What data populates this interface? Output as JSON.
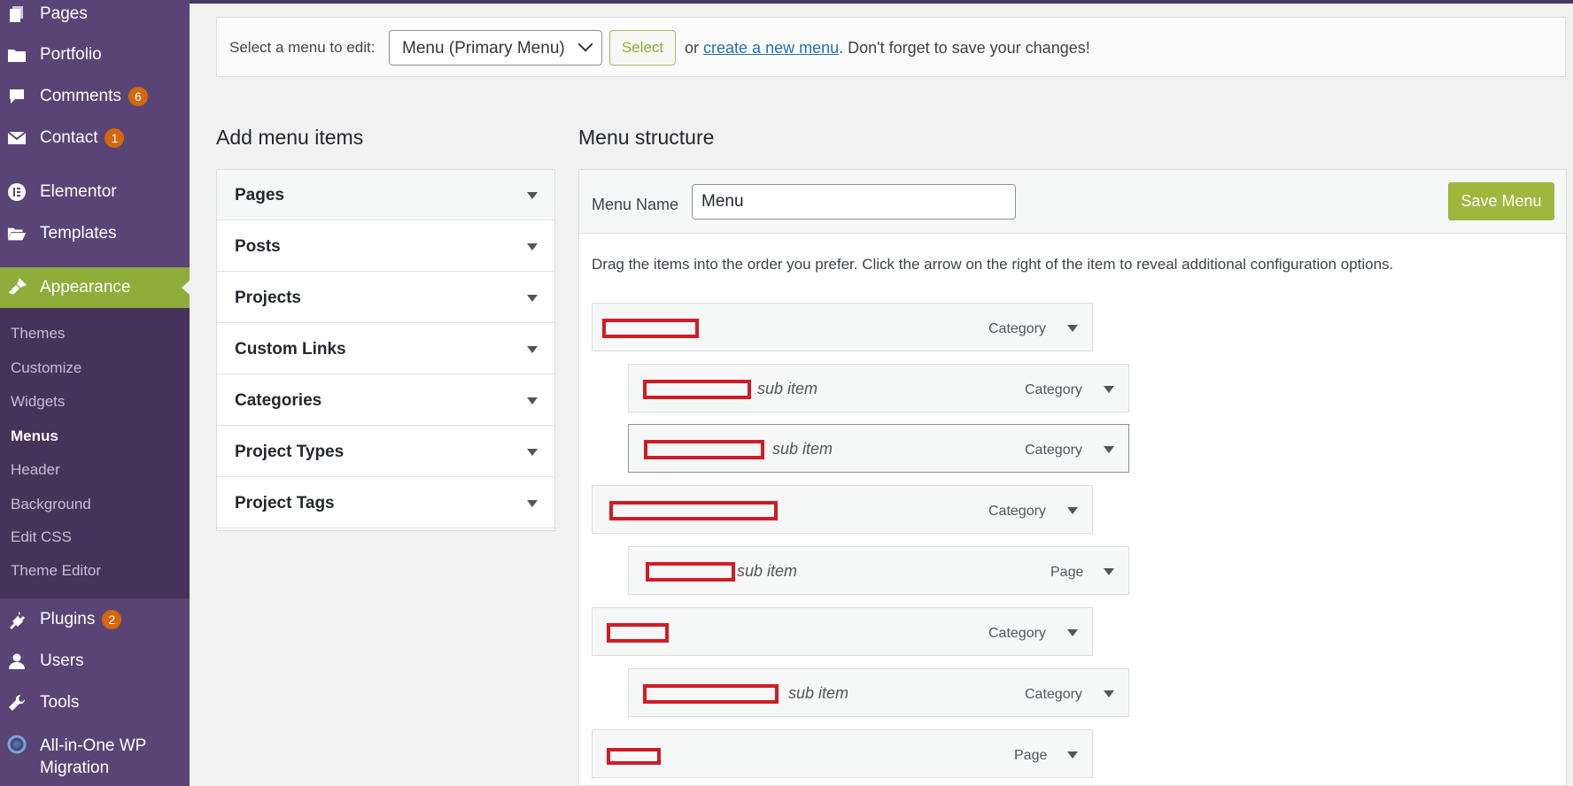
{
  "sidebar": {
    "items": [
      {
        "label": "Pages",
        "icon": "pages-icon"
      },
      {
        "label": "Portfolio",
        "icon": "folder-icon"
      },
      {
        "label": "Comments",
        "icon": "comment-icon",
        "badge": "6"
      },
      {
        "label": "Contact",
        "icon": "mail-icon",
        "badge": "1"
      },
      {
        "label": "Elementor",
        "icon": "elementor-icon"
      },
      {
        "label": "Templates",
        "icon": "folder-open-icon"
      },
      {
        "label": "Appearance",
        "icon": "brush-icon"
      },
      {
        "label": "Plugins",
        "icon": "plug-icon",
        "badge": "2"
      },
      {
        "label": "Users",
        "icon": "user-icon"
      },
      {
        "label": "Tools",
        "icon": "wrench-icon"
      },
      {
        "label": "All-in-One WP",
        "label2": "Migration",
        "icon": "migration-icon"
      }
    ],
    "submenu": [
      "Themes",
      "Customize",
      "Widgets",
      "Menus",
      "Header",
      "Background",
      "Edit CSS",
      "Theme Editor"
    ],
    "submenu_current": "Menus"
  },
  "selectbar": {
    "label": "Select a menu to edit:",
    "selected": "Menu (Primary Menu)",
    "select_button": "Select",
    "or": "or",
    "create_link": "create a new menu",
    "reminder": ". Don't forget to save your changes!"
  },
  "add_items": {
    "title": "Add menu items",
    "sections": [
      "Pages",
      "Posts",
      "Projects",
      "Custom Links",
      "Categories",
      "Project Types",
      "Project Tags"
    ]
  },
  "structure": {
    "title": "Menu structure",
    "menu_name_label": "Menu Name",
    "menu_name_value": "Menu",
    "save_button": "Save Menu",
    "instructions": "Drag the items into the order you prefer. Click the arrow on the right of the item to reveal additional configuration options.",
    "items": [
      {
        "sub_text": "",
        "type": "Category"
      },
      {
        "sub_text": "sub item",
        "type": "Category"
      },
      {
        "sub_text": "sub item",
        "type": "Category"
      },
      {
        "sub_text": "",
        "type": "Category"
      },
      {
        "sub_text": "sub item",
        "type": "Page"
      },
      {
        "sub_text": "",
        "type": "Category"
      },
      {
        "sub_text": "sub item",
        "type": "Category"
      },
      {
        "sub_text": "",
        "type": "Page"
      }
    ]
  },
  "colors": {
    "sidebar_bg": "#5a4475",
    "submenu_bg": "#45335a",
    "accent_green": "#8ead3a",
    "badge_orange": "#d5670c",
    "redaction_red": "#d01c24",
    "link_blue": "#2271b1"
  }
}
